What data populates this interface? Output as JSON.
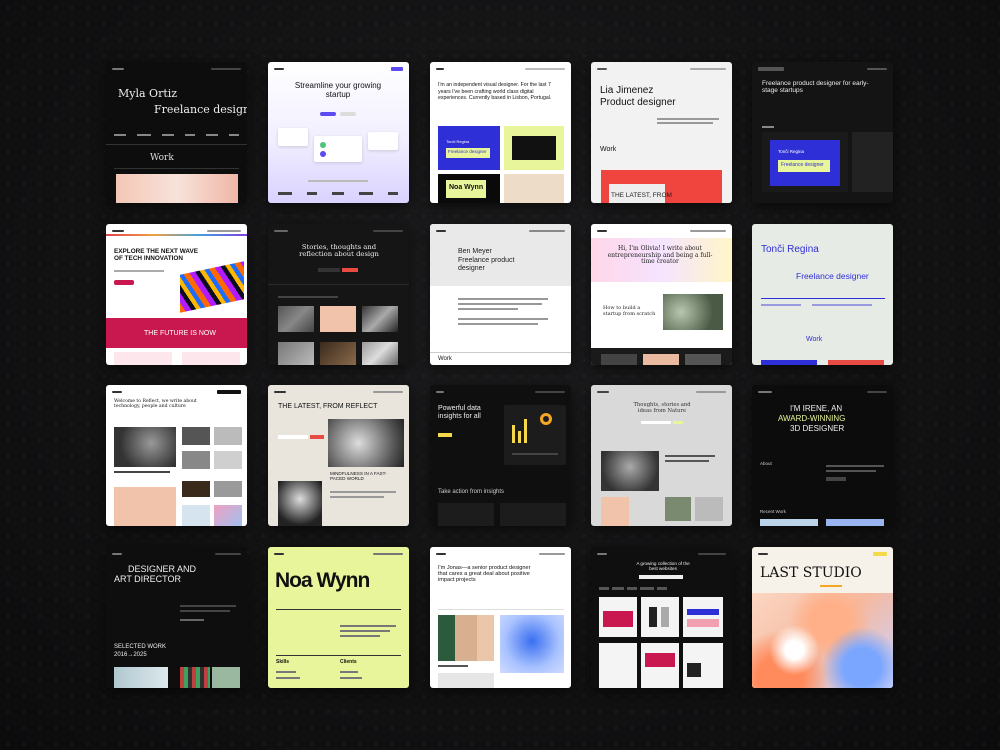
{
  "tiles": {
    "t1": {
      "line1": "Myla Ortiz",
      "line2": "Freelance designer",
      "section": "Work"
    },
    "t2": {
      "headline": "Streamline your growing startup"
    },
    "t3": {
      "intro": "I'm an independent visual designer. For the last 7 years I've been crafting world class digital experiences. Currently based in Lisbon, Portugal.",
      "card1": "Tonči Regina",
      "card2": "Freelance designer",
      "card3": "Noa Wynn"
    },
    "t4": {
      "name": "Lia Jimenez",
      "role": "Product designer",
      "section": "Work",
      "footer": "THE LATEST, FROM"
    },
    "t5": {
      "headline": "Freelance product designer for early-stage startups",
      "card1": "Tonči Regina",
      "card2": "Freelance designer"
    },
    "t6": {
      "headline": "EXPLORE THE NEXT WAVE OF TECH INNOVATION",
      "footer": "THE FUTURE IS NOW"
    },
    "t7": {
      "headline": "Stories, thoughts and reflection about design"
    },
    "t8": {
      "name": "Ben Meyer",
      "role": "Freelance product designer",
      "section": "Work"
    },
    "t9": {
      "headline": "Hi, I'm Olivia! I write about entrepreneurship and being a full-time creator",
      "sub": "How to build a startup from scratch"
    },
    "t10": {
      "name": "Tonči Regina",
      "role": "Freelance designer",
      "section": "Work"
    },
    "t11": {
      "headline": "Welcome to Reflect, we write about technology, people and culture"
    },
    "t12": {
      "headline": "THE LATEST, FROM REFLECT",
      "sub": "MINDFULNESS IN A FAST-PACED WORLD"
    },
    "t13": {
      "headline": "Powerful data insights for all",
      "sub": "Take action from insights"
    },
    "t14": {
      "headline": "Thoughts, stories and ideas from Nature"
    },
    "t15": {
      "line1": "I'M IRENE, AN",
      "line2": "AWARD-WINNING",
      "line3": "3D DESIGNER",
      "about": "About",
      "recent": "Recent Work"
    },
    "t16": {
      "line1": "DESIGNER AND",
      "line2": "ART DIRECTOR",
      "section1": "SELECTED WORK",
      "section2": "2016→2025"
    },
    "t17": {
      "name": "Noa Wynn",
      "col1": "Skills",
      "col2": "Clients"
    },
    "t18": {
      "headline": "I'm Jonas—a senior product designer that cares a great deal about positive impact projects"
    },
    "t19": {
      "headline": "A growing collection of the best websites"
    },
    "t20": {
      "headline": "LAST STUDIO"
    }
  },
  "colors": {
    "background": "#131314",
    "blue": "#2f2fd8",
    "lime": "#e9f59a",
    "red": "#e84b44",
    "magenta": "#c8184f",
    "yellow": "#f5d94a"
  }
}
